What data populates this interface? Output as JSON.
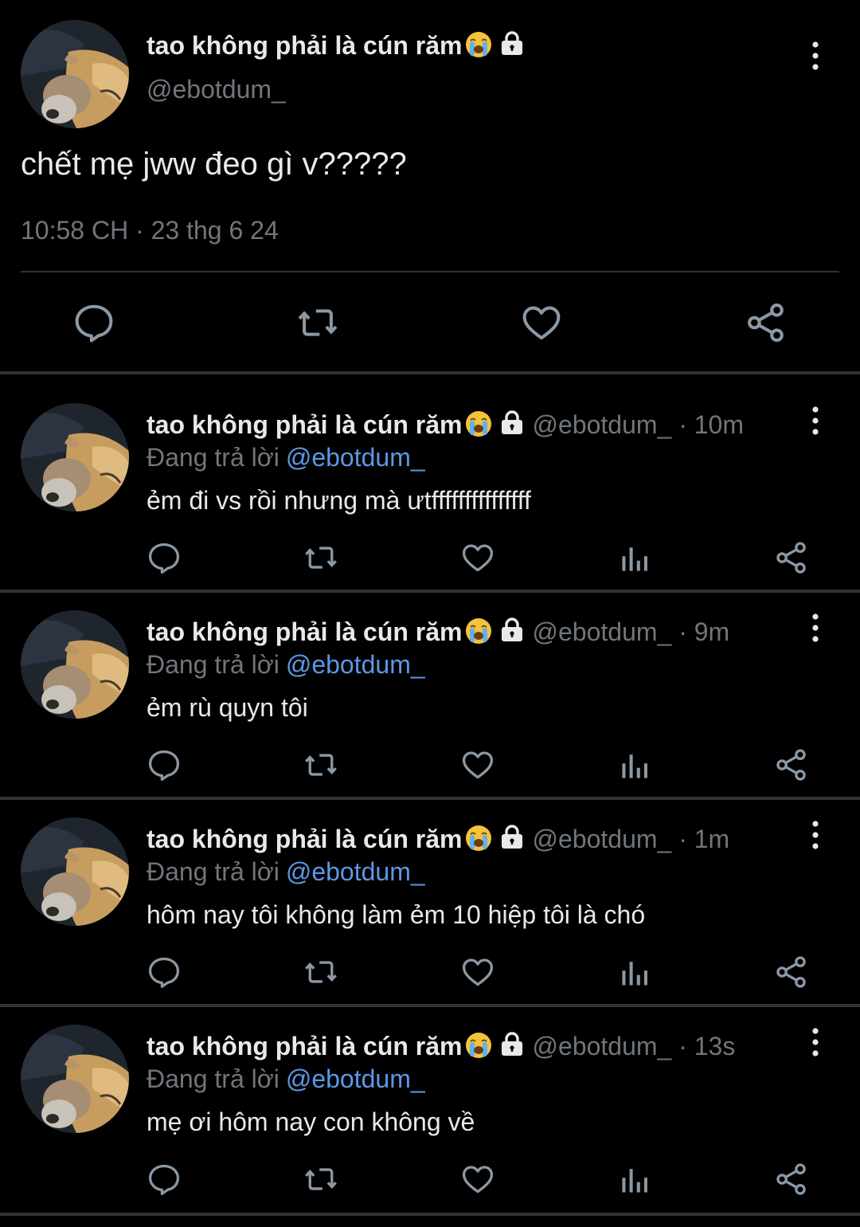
{
  "main_tweet": {
    "display_name": "tao không phải là cún răm",
    "name_emoji": "loudly-crying-face",
    "protected_icon": "lock-icon",
    "handle": "@ebotdum_",
    "text": "chết mẹ jww đeo gì v?????",
    "timestamp": "10:58 CH · 23 thg 6 24",
    "actions": [
      "reply-icon",
      "retweet-icon",
      "like-icon",
      "share-icon"
    ]
  },
  "replies": [
    {
      "display_name": "tao không phải là cún răm",
      "handle": "@ebotdum_",
      "time": " · 10m",
      "replying_label": "Đang trả lời",
      "replying_to": "@ebotdum_",
      "text": "ẻm đi vs rồi nhưng mà ưtfffffffffffffff"
    },
    {
      "display_name": "tao không phải là cún răm",
      "handle": "@ebotdum_",
      "time": " · 9m",
      "replying_label": "Đang trả lời",
      "replying_to": "@ebotdum_",
      "text": "ẻm rù quyn tôi"
    },
    {
      "display_name": "tao không phải là cún răm",
      "handle": "@ebotdum_",
      "time": " · 1m",
      "replying_label": "Đang trả lời",
      "replying_to": "@ebotdum_",
      "text": "hôm nay tôi không làm ẻm 10 hiệp tôi là chó"
    },
    {
      "display_name": "tao không phải là cún răm",
      "handle": "@ebotdum_",
      "time": " · 13s",
      "replying_label": "Đang trả lời",
      "replying_to": "@ebotdum_",
      "text": "mẹ ơi hôm nay con không về"
    }
  ],
  "colors": {
    "background": "#000000",
    "text": "#e7e9ea",
    "secondary": "#71767b",
    "link": "#5b98e6",
    "divider": "#2f3336"
  }
}
